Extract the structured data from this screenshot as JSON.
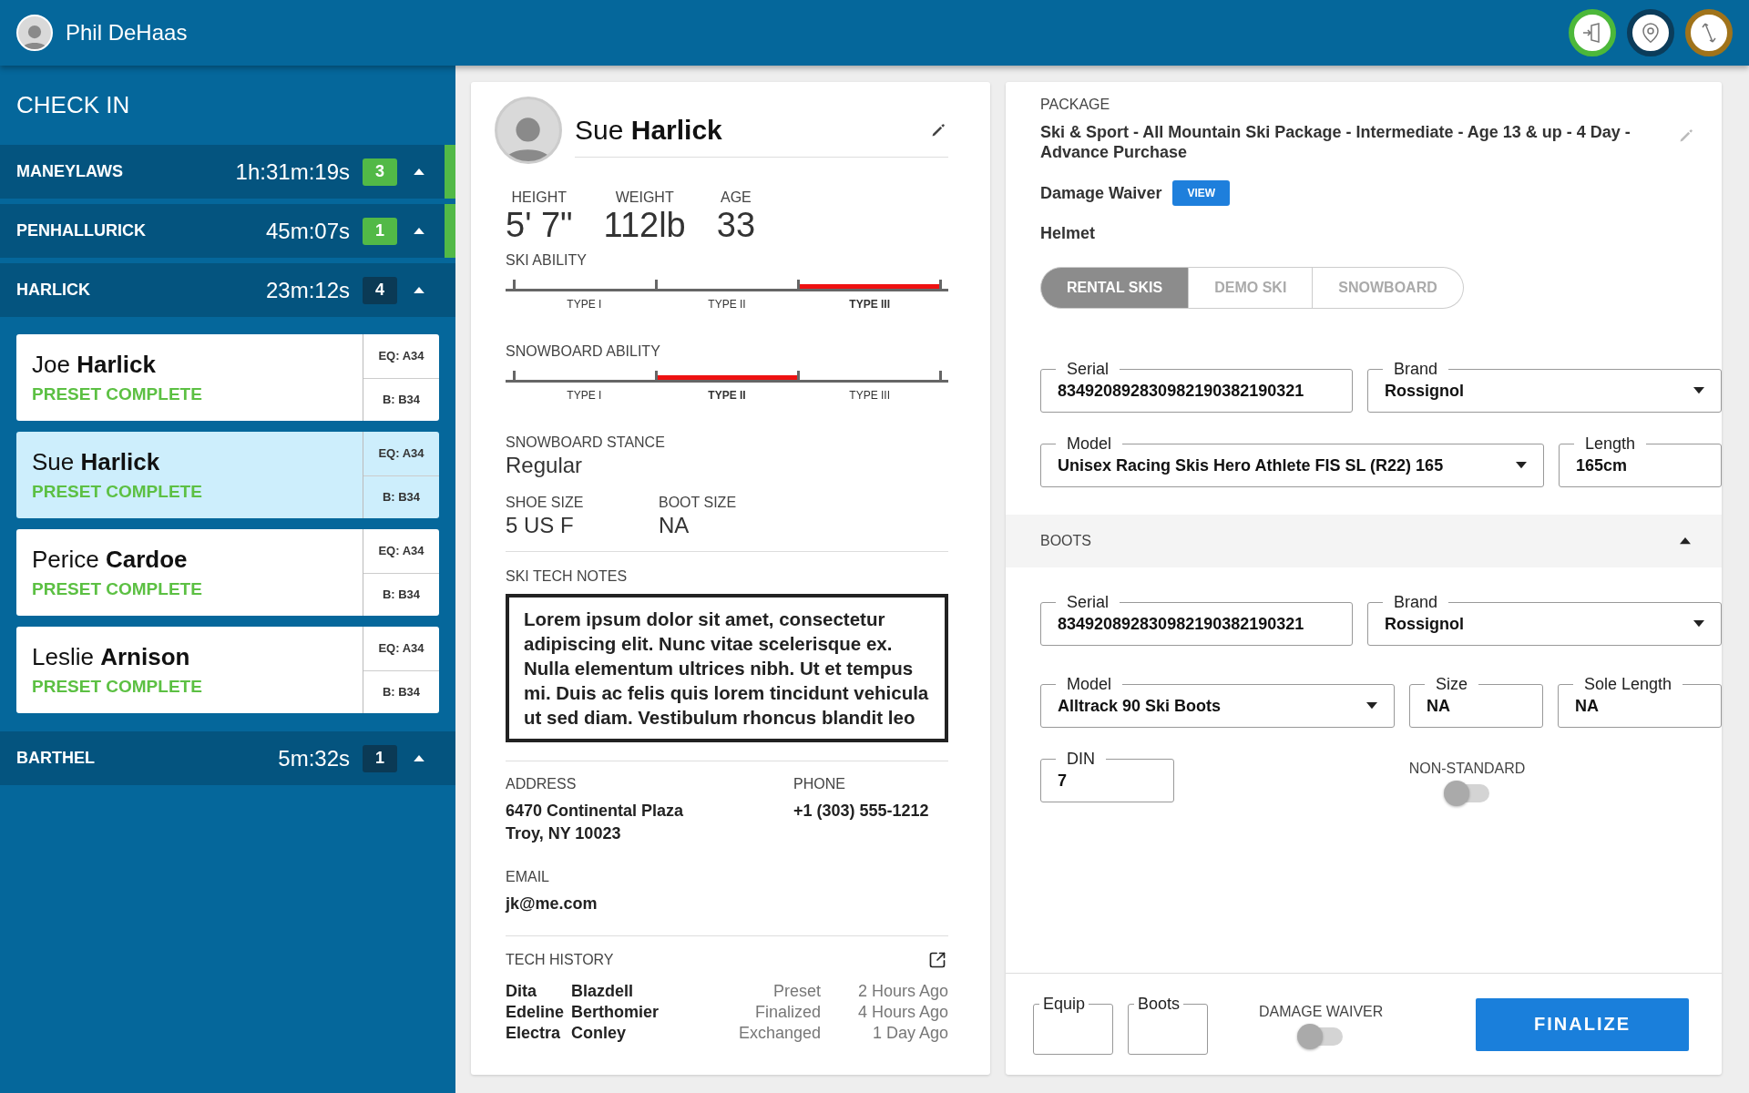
{
  "header": {
    "user_name": "Phil DeHaas",
    "actions": [
      {
        "kind": "check-in",
        "color": "#4cb83a"
      },
      {
        "kind": "location",
        "color": "#0b3c5a"
      },
      {
        "kind": "exchange",
        "color": "#a0731a"
      }
    ]
  },
  "sidebar": {
    "title": "CHECK IN",
    "groups": [
      {
        "name": "MANEYLAWS",
        "timer": "1h:31m:19s",
        "count": "3",
        "color": "#52b947",
        "alert": true
      },
      {
        "name": "PENHALLURICK",
        "timer": "45m:07s",
        "count": "1",
        "color": "#52b947",
        "alert": true
      },
      {
        "name": "HARLICK",
        "timer": "23m:12s",
        "count": "4",
        "color": "#0b3a55",
        "alert": false,
        "members": [
          {
            "first": "Joe",
            "last": "Harlick",
            "status": "PRESET COMPLETE",
            "equipment": "EQ: A34",
            "boots": "B: B34",
            "selected": false
          },
          {
            "first": "Sue",
            "last": "Harlick",
            "status": "PRESET COMPLETE",
            "equipment": "EQ: A34",
            "boots": "B: B34",
            "selected": true
          },
          {
            "first": "Perice",
            "last": "Cardoe",
            "status": "PRESET COMPLETE",
            "equipment": "EQ: A34",
            "boots": "B: B34",
            "selected": false
          },
          {
            "first": "Leslie",
            "last": "Arnison",
            "status": "PRESET COMPLETE",
            "equipment": "EQ: A34",
            "boots": "B: B34",
            "selected": false
          }
        ]
      },
      {
        "name": "BARTHEL",
        "timer": "5m:32s",
        "count": "1",
        "color": "#0b3a55",
        "alert": false
      }
    ]
  },
  "profile": {
    "first_name": "Sue",
    "last_name": "Harlick",
    "stats": [
      {
        "label": "HEIGHT",
        "value": "5' 7\""
      },
      {
        "label": "WEIGHT",
        "value": "112lb"
      },
      {
        "label": "AGE",
        "value": "33"
      }
    ],
    "abilities": [
      {
        "label": "SKI ABILITY",
        "levels": [
          {
            "label": "TYPE I",
            "selected": false
          },
          {
            "label": "TYPE II",
            "selected": false
          },
          {
            "label": "TYPE III",
            "selected": true
          }
        ]
      },
      {
        "label": "SNOWBOARD ABILITY",
        "levels": [
          {
            "label": "TYPE I",
            "selected": false
          },
          {
            "label": "TYPE II",
            "selected": true
          },
          {
            "label": "TYPE III",
            "selected": false
          }
        ]
      }
    ],
    "stance": {
      "label": "SNOWBOARD STANCE",
      "value": "Regular"
    },
    "sizes": [
      {
        "label": "SHOE SIZE",
        "value": "5 US F"
      },
      {
        "label": "BOOT SIZE",
        "value": "NA"
      }
    ],
    "notes": {
      "label": "SKI TECH NOTES",
      "text": "Lorem ipsum dolor sit amet, consectetur adipiscing elit. Nunc vitae scelerisque ex. Nulla elementum ultrices nibh. Ut et tempus mi. Duis ac felis quis lorem tincidunt vehicula ut sed diam. Vestibulum rhoncus blandit leo"
    },
    "contact": [
      {
        "label": "ADDRESS",
        "lines": [
          "6470 Continental Plaza",
          "Troy, NY 10023"
        ]
      },
      {
        "label": "PHONE",
        "lines": [
          "+1 (303) 555-1212"
        ]
      },
      {
        "label": "EMAIL",
        "lines": [
          "jk@me.com"
        ]
      }
    ],
    "tech_history": {
      "title": "TECH HISTORY",
      "rows": [
        {
          "first": "Dita",
          "last": "Blazdell",
          "action": "Preset",
          "time": "2 Hours Ago"
        },
        {
          "first": "Edeline",
          "last": "Berthomier",
          "action": "Finalized",
          "time": "4 Hours Ago"
        },
        {
          "first": "Electra",
          "last": "Conley",
          "action": "Exchanged",
          "time": "1 Day Ago"
        }
      ]
    }
  },
  "rental": {
    "package_label": "PACKAGE",
    "package": "Ski & Sport - All Mountain Ski Package - Intermediate - Age 13 & up - 4 Day - Advance Purchase",
    "damage_waiver": {
      "label": "Damage Waiver",
      "button": "VIEW"
    },
    "helmet": "Helmet",
    "tabs": [
      {
        "label": "RENTAL SKIS",
        "selected": true
      },
      {
        "label": "DEMO SKI",
        "selected": false
      },
      {
        "label": "SNOWBOARD",
        "selected": false
      }
    ],
    "ski_rows": [
      [
        {
          "kind": "text",
          "label": "Serial",
          "value": "834920892830982190382190321"
        },
        {
          "kind": "select",
          "label": "Brand",
          "value": "Rossignol"
        }
      ],
      [
        {
          "kind": "select",
          "label": "Model",
          "value": "Unisex Racing Skis Hero Athlete FIS SL (R22) 165"
        },
        {
          "kind": "text",
          "label": "Length",
          "value": "165cm"
        }
      ]
    ],
    "boots": {
      "title": "BOOTS",
      "expanded": true,
      "rows": [
        [
          {
            "kind": "text",
            "label": "Serial",
            "value": "834920892830982190382190321"
          },
          {
            "kind": "select",
            "label": "Brand",
            "value": "Rossignol"
          }
        ],
        [
          {
            "kind": "select",
            "label": "Model",
            "value": "Alltrack 90 Ski Boots"
          },
          {
            "kind": "text",
            "label": "Size",
            "value": "NA"
          },
          {
            "kind": "text",
            "label": "Sole Length",
            "value": "NA"
          }
        ],
        [
          {
            "kind": "text",
            "label": "DIN",
            "value": "7"
          },
          {
            "kind": "toggle",
            "label": "NON-STANDARD",
            "on": false
          }
        ]
      ]
    },
    "footer": {
      "fields": [
        {
          "label": "Equip"
        },
        {
          "label": "Boots"
        }
      ],
      "damage_waiver": {
        "label": "DAMAGE WAIVER",
        "on": false
      },
      "finalize": "FINALIZE"
    }
  }
}
